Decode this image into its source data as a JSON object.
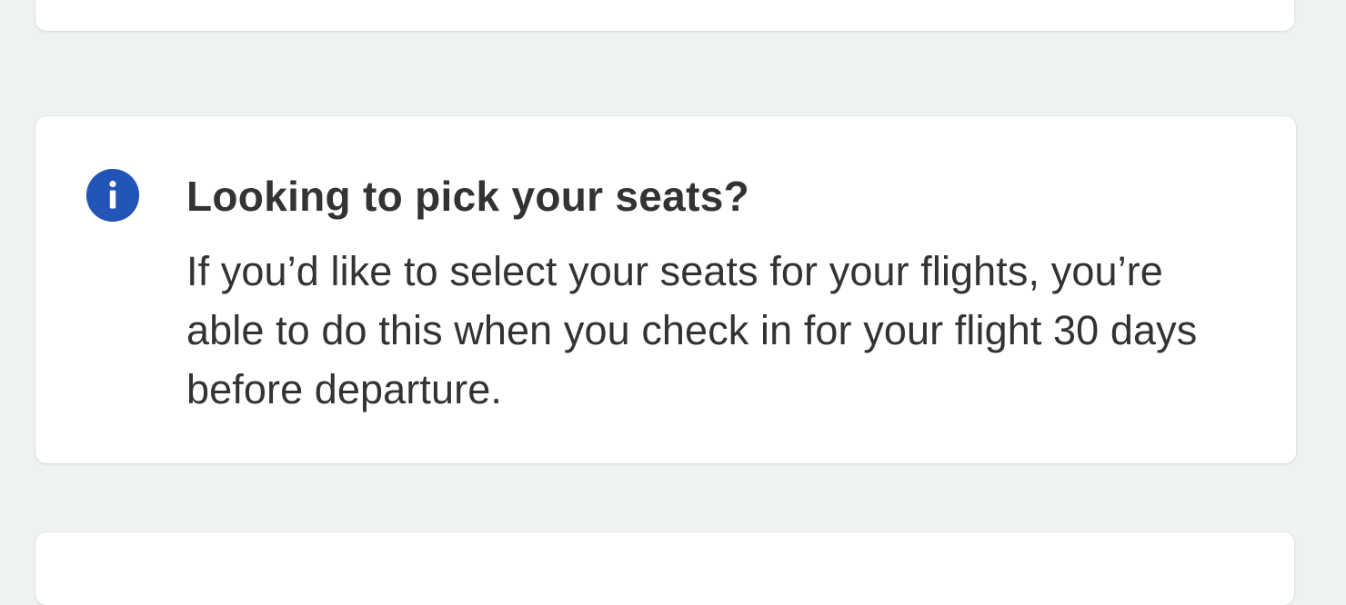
{
  "info_card": {
    "icon": "info-icon",
    "icon_color": "#2354b8",
    "title": "Looking to pick your seats?",
    "body": "If you’d like to select your seats for your flights, you’re able to do this when you check in for your flight 30 days before departure."
  },
  "colors": {
    "background": "#eff2f3",
    "card": "#ffffff",
    "text": "#333333"
  }
}
